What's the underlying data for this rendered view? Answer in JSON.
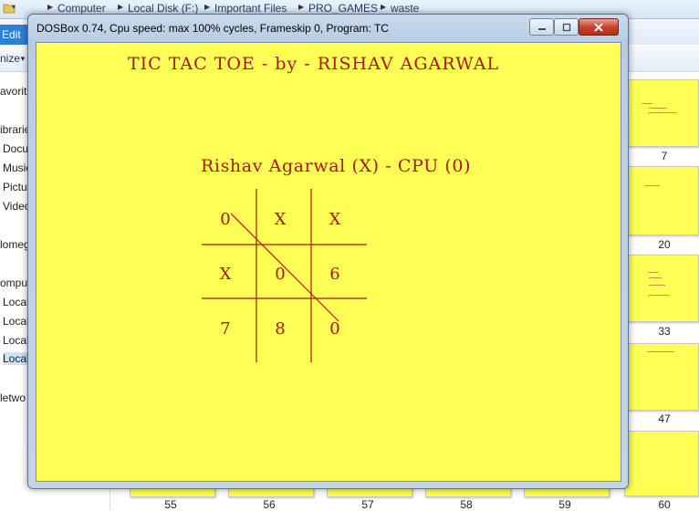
{
  "explorer": {
    "breadcrumb": [
      "Computer",
      "Local Disk (F:)",
      "Important Files",
      "PRO_GAMES",
      "waste"
    ],
    "menu_selected": "Edit",
    "toolbar": {
      "organize_label": "nize"
    },
    "nav_items": [
      {
        "label": "avorite",
        "selected": false
      },
      {
        "label": "ibrarie",
        "selected": false
      },
      {
        "label": "Docu",
        "selected": false
      },
      {
        "label": "Music",
        "selected": false
      },
      {
        "label": "Pictu",
        "selected": false
      },
      {
        "label": "Video",
        "selected": false
      },
      {
        "label": "lomeg",
        "selected": false
      },
      {
        "label": "ompu",
        "selected": false
      },
      {
        "label": "Local",
        "selected": false
      },
      {
        "label": "Local",
        "selected": false
      },
      {
        "label": "Local",
        "selected": false
      },
      {
        "label": "Local",
        "selected": true
      },
      {
        "label": "letwo",
        "selected": false
      }
    ],
    "thumb_labels_right": [
      "7",
      "20",
      "33",
      "47"
    ],
    "thumb_labels_bottom": [
      "55",
      "56",
      "57",
      "58",
      "59",
      "60"
    ],
    "colors": {
      "thumb_bg": "#ffff55",
      "selection": "#cde4f7"
    }
  },
  "dosbox": {
    "title": "DOSBox 0.74, Cpu speed: max 100% cycles, Frameskip  0, Program:     TC",
    "buttons": [
      "minimize-icon",
      "maximize-icon",
      "close-icon"
    ],
    "game": {
      "title": "TIC TAC TOE - by - RISHAV AGARWAL",
      "players": "Rishav Agarwal (X)  -  CPU (0)",
      "board": [
        [
          "0",
          "X",
          "X"
        ],
        [
          "X",
          "0",
          "6"
        ],
        [
          "7",
          "8",
          "0"
        ]
      ],
      "winning_line": "diagonal top-left to bottom-right",
      "colors": {
        "screen_bg": "#ffff55",
        "text": "#a81818"
      }
    }
  }
}
